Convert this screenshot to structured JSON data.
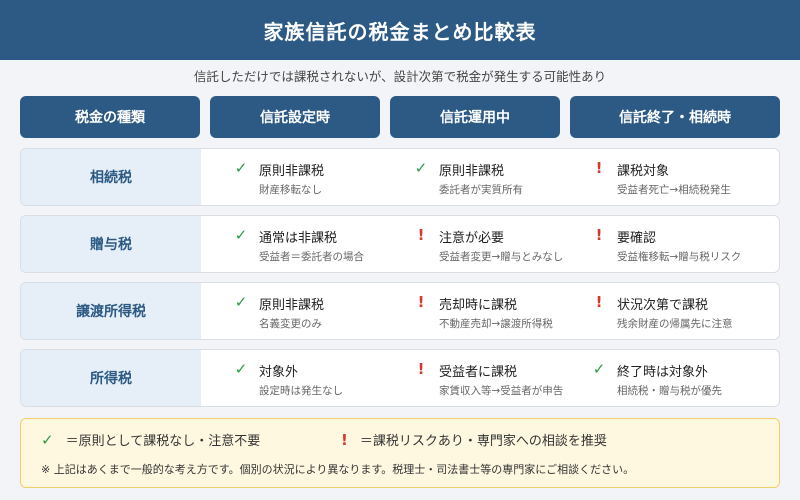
{
  "title": "家族信託の税金まとめ比較表",
  "subtitle": "信託しただけでは課税されないが、設計次第で税金が発生する可能性あり",
  "columns": [
    "税金の種類",
    "信託設定時",
    "信託運用中",
    "信託終了・相続時"
  ],
  "colors": {
    "header": "#2c5a84",
    "ok": "#2e9a4a",
    "warn": "#d23a2e",
    "label_bg": "#e6eef8",
    "legend_bg": "#fff8e1"
  },
  "rows": [
    {
      "label": "相続税",
      "cells": [
        {
          "icon": "✓",
          "status": "ok",
          "main": "原則非課税",
          "sub": "財産移転なし"
        },
        {
          "icon": "✓",
          "status": "ok",
          "main": "原則非課税",
          "sub": "委託者が実質所有"
        },
        {
          "icon": "!",
          "status": "warn",
          "main": "課税対象",
          "sub": "受益者死亡→相続税発生"
        }
      ]
    },
    {
      "label": "贈与税",
      "cells": [
        {
          "icon": "✓",
          "status": "ok",
          "main": "通常は非課税",
          "sub": "受益者＝委託者の場合"
        },
        {
          "icon": "!",
          "status": "warn",
          "main": "注意が必要",
          "sub": "受益者変更→贈与とみなし"
        },
        {
          "icon": "!",
          "status": "warn",
          "main": "要確認",
          "sub": "受益権移転→贈与税リスク"
        }
      ]
    },
    {
      "label": "譲渡所得税",
      "cells": [
        {
          "icon": "✓",
          "status": "ok",
          "main": "原則非課税",
          "sub": "名義変更のみ"
        },
        {
          "icon": "!",
          "status": "warn",
          "main": "売却時に課税",
          "sub": "不動産売却→譲渡所得税"
        },
        {
          "icon": "!",
          "status": "warn",
          "main": "状況次第で課税",
          "sub": "残余財産の帰属先に注意"
        }
      ]
    },
    {
      "label": "所得税",
      "cells": [
        {
          "icon": "✓",
          "status": "ok",
          "main": "対象外",
          "sub": "設定時は発生なし"
        },
        {
          "icon": "!",
          "status": "warn",
          "main": "受益者に課税",
          "sub": "家賃収入等→受益者が申告"
        },
        {
          "icon": "✓",
          "status": "ok",
          "main": "終了時は対象外",
          "sub": "相続税・贈与税が優先"
        }
      ]
    }
  ],
  "legend": {
    "ok_icon": "✓",
    "ok_text": "＝原則として課税なし・注意不要",
    "warn_icon": "!",
    "warn_text": "＝課税リスクあり・専門家への相談を推奨",
    "note": "※ 上記はあくまで一般的な考え方です。個別の状況により異なります。税理士・司法書士等の専門家にご相談ください。"
  }
}
